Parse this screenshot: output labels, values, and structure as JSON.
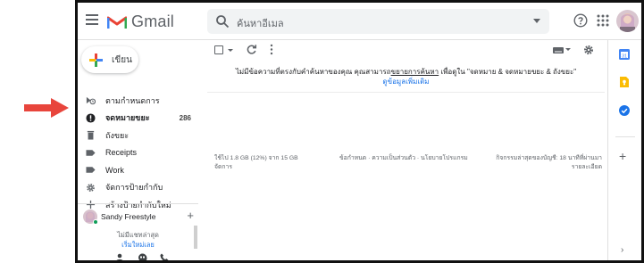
{
  "app": {
    "name": "Gmail",
    "brand_colors": {
      "red": "#ea4335",
      "blue": "#4285f4",
      "green": "#34a853",
      "yellow": "#fbbc04"
    }
  },
  "header": {
    "search_placeholder": "ค้นหาอีเมล",
    "icons": [
      "menu-icon",
      "gmail-logo",
      "search-icon",
      "help-icon",
      "apps-icon",
      "avatar"
    ]
  },
  "sidebar": {
    "compose_label": "เขียน",
    "items": [
      {
        "label": "",
        "icon": "partial-icon"
      },
      {
        "label": "ตามกำหนดการ",
        "icon": "scheduled-icon",
        "count": ""
      },
      {
        "label": "จดหมายขยะ",
        "icon": "spam-icon",
        "count": "286",
        "bold": true
      },
      {
        "label": "ถังขยะ",
        "icon": "trash-icon",
        "count": ""
      },
      {
        "label": "Receipts",
        "icon": "label-icon",
        "count": ""
      },
      {
        "label": "Work",
        "icon": "label-icon",
        "count": ""
      },
      {
        "label": "จัดการป้ายกำกับ",
        "icon": "gear-icon",
        "count": ""
      },
      {
        "label": "สร้างป้ายกำกับใหม่",
        "icon": "plus-icon",
        "count": ""
      }
    ],
    "hangouts": {
      "user_name": "Sandy Freestyle",
      "status_color": "#0f9d58",
      "no_chats": "ไม่มีแชทล่าสุด",
      "start_new": "เริ่มใหม่เลย"
    }
  },
  "main": {
    "message_line1_a": "ไม่มีข้อความที่ตรงกับคำค้นหาของคุณ คุณสามารถ",
    "message_line1_link": "ขยายการค้นหา",
    "message_line1_b": " เพื่อดูใน \"จดหมาย & จดหมายขยะ & ถังขยะ\"",
    "message_line2_link": "ดูข้อมูลเพิ่มเติม",
    "footer": {
      "storage": "ใช้ไป 1.8 GB (12%) จาก 15 GB",
      "storage_manage": "จัดการ",
      "terms": "ข้อกำหนด · ความเป็นส่วนตัว · นโยบายโปรแกรม",
      "activity": "กิจกรรมล่าสุดของบัญชี: 18 นาทีที่ผ่านมา",
      "details": "รายละเอียด"
    }
  },
  "sidepanel": {
    "icons": [
      "calendar-icon",
      "keep-icon",
      "tasks-icon",
      "add-addon-icon",
      "expand-chevron-icon"
    ]
  }
}
